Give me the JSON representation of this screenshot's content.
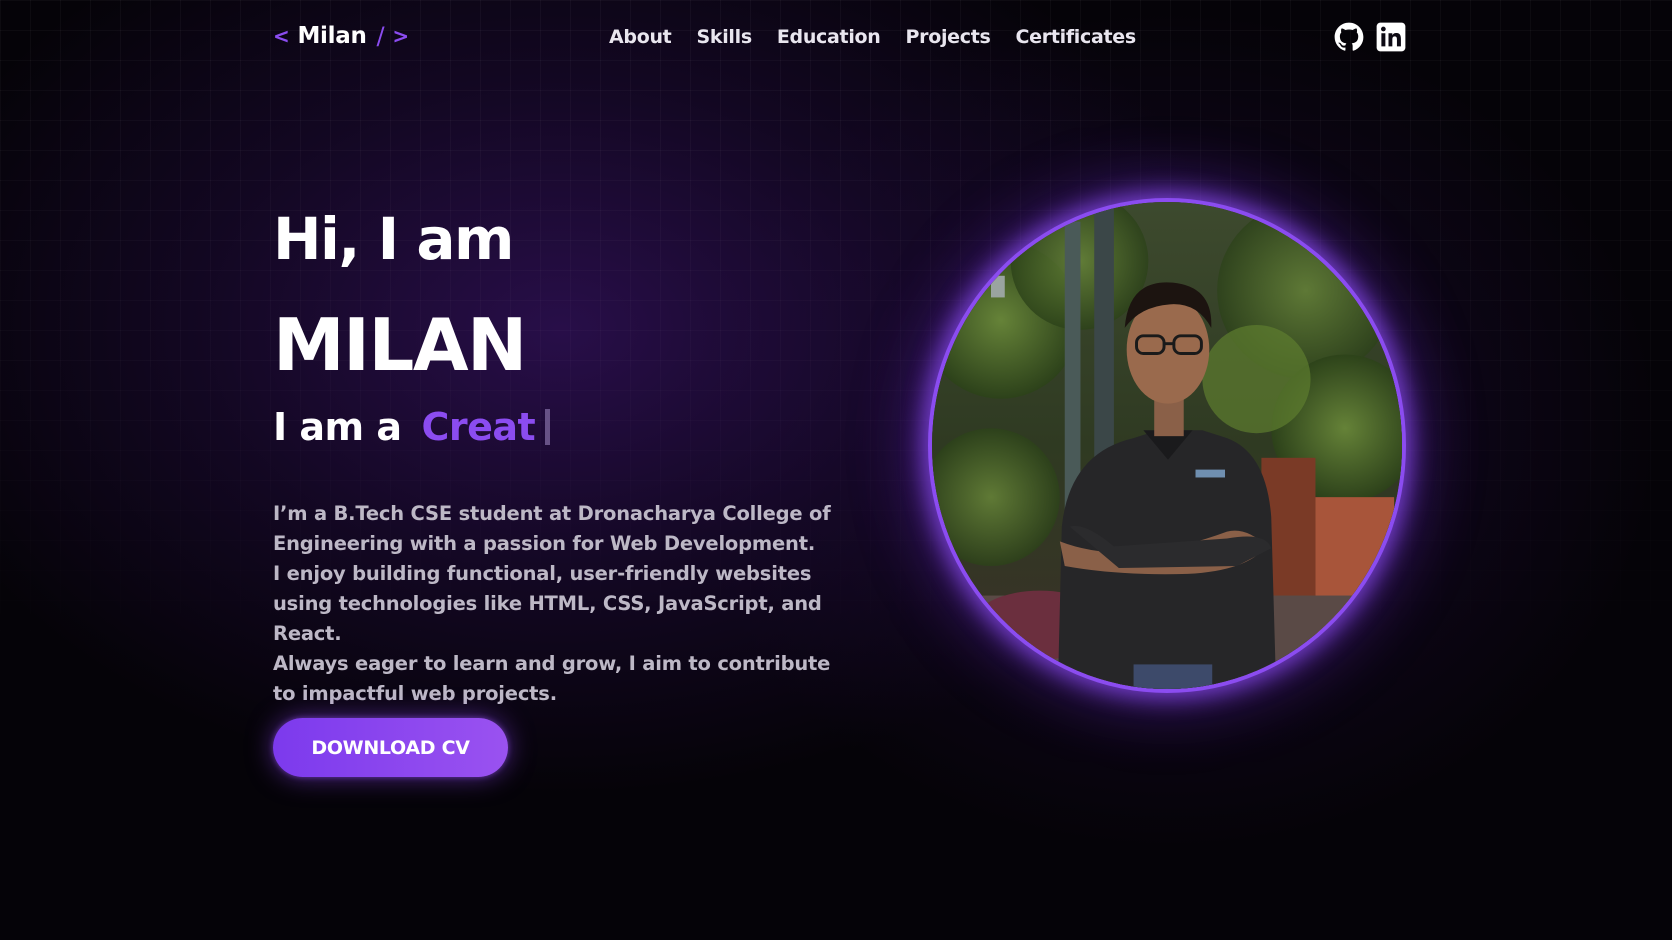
{
  "nav": {
    "logo": {
      "open": "<",
      "name": "Milan",
      "slash": "/",
      "close": ">"
    },
    "links": [
      "About",
      "Skills",
      "Education",
      "Projects",
      "Certificates"
    ],
    "socials": [
      "github-icon",
      "linkedin-icon"
    ]
  },
  "hero": {
    "greeting": "Hi, I am",
    "name": "MILAN",
    "role_prefix": "I am a",
    "role_typed": "Creat",
    "bio": [
      "I’m a B.Tech CSE student at Dronacharya College of Engineering with a passion for Web Development.",
      "I enjoy building functional, user-friendly websites using technologies like HTML, CSS, JavaScript, and React.",
      "Always eager to learn and grow, I aim to contribute to impactful web projects."
    ],
    "cta": "DOWNLOAD CV",
    "photo_alt": "profile-photo"
  },
  "colors": {
    "accent": "#8b4cf0",
    "background": "#050308",
    "text_muted": "#bdb8c6"
  }
}
